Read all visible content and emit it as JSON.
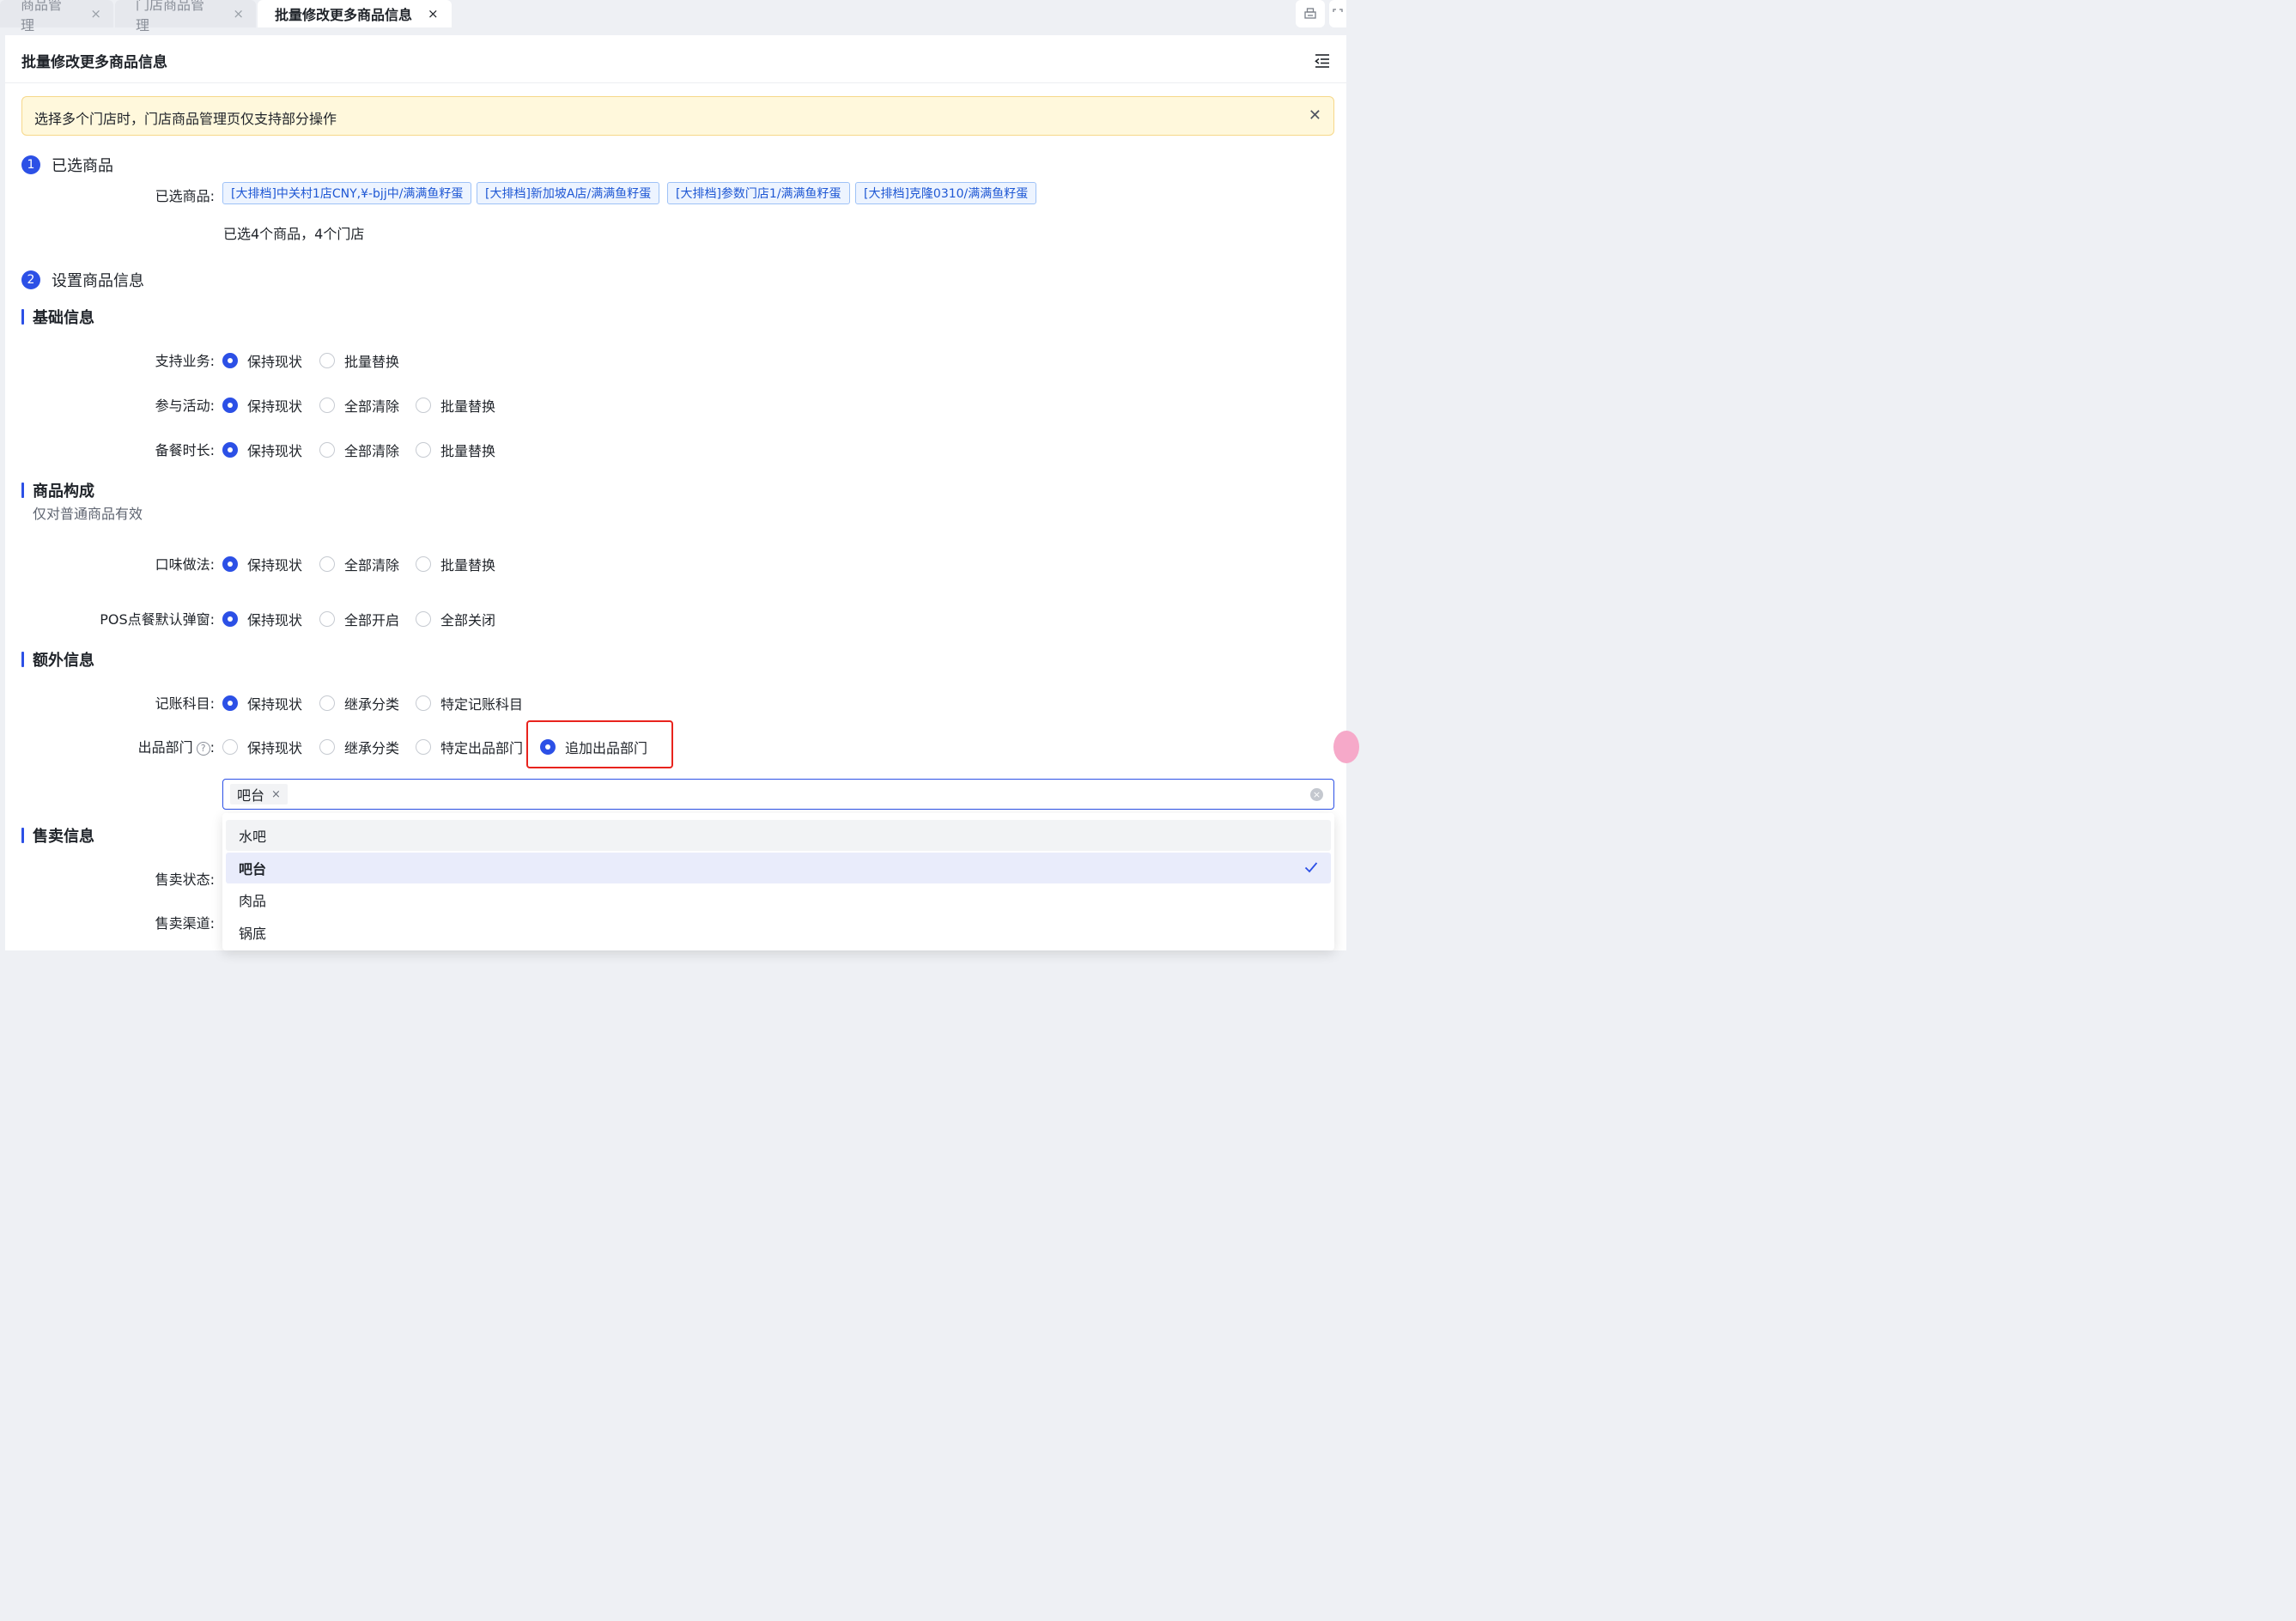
{
  "tabs": [
    {
      "label": "商品管理",
      "close": "×"
    },
    {
      "label": "门店商品管理",
      "close": "×"
    },
    {
      "label": "批量修改更多商品信息",
      "close": "×"
    }
  ],
  "page": {
    "title": "批量修改更多商品信息",
    "alert": "选择多个门店时，门店商品管理页仅支持部分操作",
    "alert_close": "✕"
  },
  "step1": {
    "num": "1",
    "label": "已选商品",
    "field_label": "已选商品:",
    "tags": [
      "[大排档]中关村1店CNY,¥-bjj中/满满鱼籽蛋",
      "[大排档]新加坡A店/满满鱼籽蛋",
      "[大排档]参数门店1/满满鱼籽蛋",
      "[大排档]克隆0310/满满鱼籽蛋"
    ],
    "summary": "已选4个商品，4个门店"
  },
  "step2": {
    "num": "2",
    "label": "设置商品信息"
  },
  "basic": {
    "title": "基础信息",
    "rows": [
      {
        "label": "支持业务:",
        "options": [
          "保持现状",
          "批量替换"
        ]
      },
      {
        "label": "参与活动:",
        "options": [
          "保持现状",
          "全部清除",
          "批量替换"
        ]
      },
      {
        "label": "备餐时长:",
        "options": [
          "保持现状",
          "全部清除",
          "批量替换"
        ]
      }
    ]
  },
  "composition": {
    "title": "商品构成",
    "subtitle": "仅对普通商品有效",
    "rows": [
      {
        "label": "口味做法:",
        "options": [
          "保持现状",
          "全部清除",
          "批量替换"
        ]
      },
      {
        "label": "POS点餐默认弹窗:",
        "options": [
          "保持现状",
          "全部开启",
          "全部关闭"
        ]
      }
    ]
  },
  "extra": {
    "title": "额外信息",
    "rows": [
      {
        "label": "记账科目:",
        "options": [
          "保持现状",
          "继承分类",
          "特定记账科目"
        ]
      },
      {
        "label": "出品部门",
        "help": "?",
        "colon": ":",
        "options": [
          "保持现状",
          "继承分类",
          "特定出品部门",
          "追加出品部门"
        ]
      }
    ]
  },
  "dept_select": {
    "chip": "吧台",
    "chip_remove": "×",
    "clear": "×",
    "options": [
      "水吧",
      "吧台",
      "肉品",
      "锅底"
    ],
    "selected": "吧台",
    "hovered": "水吧"
  },
  "sales": {
    "title": "售卖信息",
    "rows": [
      {
        "label": "售卖状态:"
      },
      {
        "label": "售卖渠道:"
      }
    ]
  },
  "colors": {
    "accent": "#2c50e6",
    "highlight": "#e8231d",
    "alert_bg": "#fff8dc"
  },
  "icons": [
    "close-icon",
    "print-icon",
    "fullscreen-icon",
    "collapse-menu-icon",
    "help-icon",
    "clear-icon",
    "check-icon"
  ]
}
